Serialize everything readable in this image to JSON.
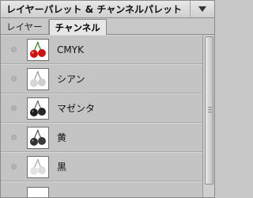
{
  "panel": {
    "title": "レイヤーパレット & チャンネルパレット",
    "menu_icon": "triangle-down-icon"
  },
  "tabs": [
    {
      "label": "レイヤー",
      "active": false
    },
    {
      "label": "チャンネル",
      "active": true
    }
  ],
  "channels": [
    {
      "name": "CMYK",
      "thumb_color": "#cc1111"
    },
    {
      "name": "シアン",
      "thumb_color": "#d6d6d6"
    },
    {
      "name": "マゼンタ",
      "thumb_color": "#222222"
    },
    {
      "name": "黄",
      "thumb_color": "#333333"
    },
    {
      "name": "黒",
      "thumb_color": "#e0e0e0"
    }
  ],
  "colors": {
    "panel_bg": "#c6c6c6",
    "tab_active_bg": "#e6e6e6"
  }
}
